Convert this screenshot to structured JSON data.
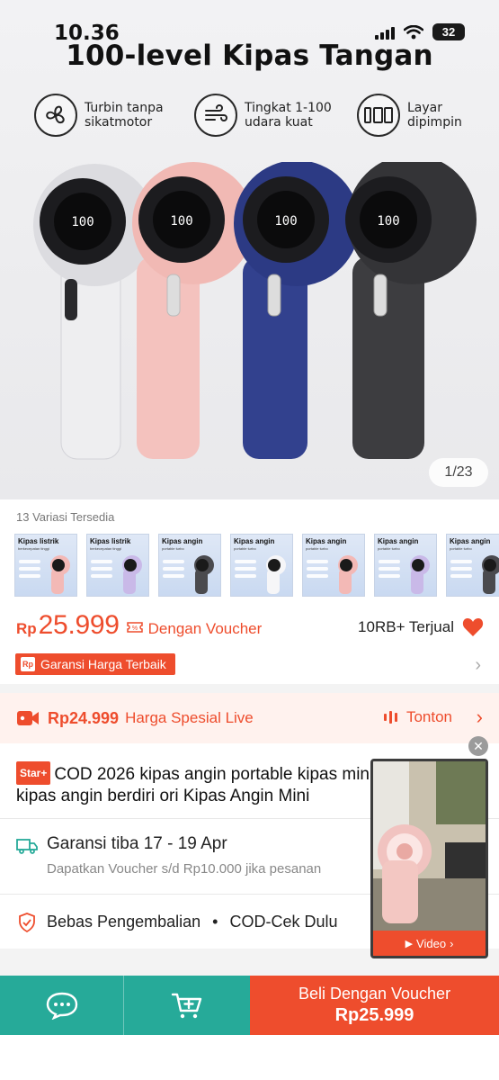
{
  "status_bar": {
    "time": "10.36",
    "battery": "32"
  },
  "banner": {
    "title": "100-level Kipas Tangan",
    "features": [
      {
        "icon": "fan-icon",
        "text": "Turbin tanpa\nsikatmotor"
      },
      {
        "icon": "wind-icon",
        "text": "Tingkat 1-100\nudara kuat"
      },
      {
        "icon": "digital-display-icon",
        "text": "Layar\ndipimpin"
      }
    ],
    "fans": [
      {
        "color": "#e9e9ec",
        "display": "100"
      },
      {
        "color": "#f2b8b4",
        "display": "100"
      },
      {
        "color": "#2f3f8c",
        "display": "100"
      },
      {
        "color": "#3b3b3e",
        "display": "100"
      }
    ],
    "counter": "1/23"
  },
  "variants": {
    "title": "13 Variasi Tersedia",
    "thumbs": [
      {
        "label": "Kipas listrik",
        "sub": "berkecepatan tinggi",
        "color": "#f3b9b6"
      },
      {
        "label": "Kipas listrik",
        "sub": "berkecepatan tinggi",
        "color": "#c9b9e8"
      },
      {
        "label": "Kipas angin",
        "sub": "portable turbo",
        "color": "#4a4a4e"
      },
      {
        "label": "Kipas angin",
        "sub": "portable turbo",
        "color": "#f6f6f8"
      },
      {
        "label": "Kipas angin",
        "sub": "portable turbo",
        "color": "#f3b9b6"
      },
      {
        "label": "Kipas angin",
        "sub": "portable turbo",
        "color": "#c9b9e8"
      },
      {
        "label": "Kipas angin",
        "sub": "portable turbo",
        "color": "#4a4a4e"
      }
    ]
  },
  "price": {
    "currency": "Rp",
    "amount": "25.999",
    "voucher_label": "Dengan Voucher",
    "sold": "10RB+ Terjual",
    "best_price_badge": "Garansi Harga Terbaik"
  },
  "live": {
    "price": "Rp24.999",
    "label": "Harga Spesial Live",
    "watch": "Tonton"
  },
  "product": {
    "badge": "Star+",
    "title": "COD 2026 kipas angin portable kipas mini kipas angin berdiri ori Kipas Angin Mini"
  },
  "shipping": {
    "title": "Garansi tiba 17 - 19 Apr",
    "subtitle": "Dapatkan Voucher s/d Rp10.000 jika pesanan"
  },
  "returns": {
    "text": "Bebas Pengembalian",
    "separator": "•",
    "cod": "COD-Cek Dulu"
  },
  "video": {
    "label": "Video"
  },
  "bottom_bar": {
    "buy_label": "Beli Dengan Voucher",
    "buy_price": "Rp25.999"
  },
  "colors": {
    "brand": "#ee4d2d",
    "teal": "#26aa99"
  }
}
